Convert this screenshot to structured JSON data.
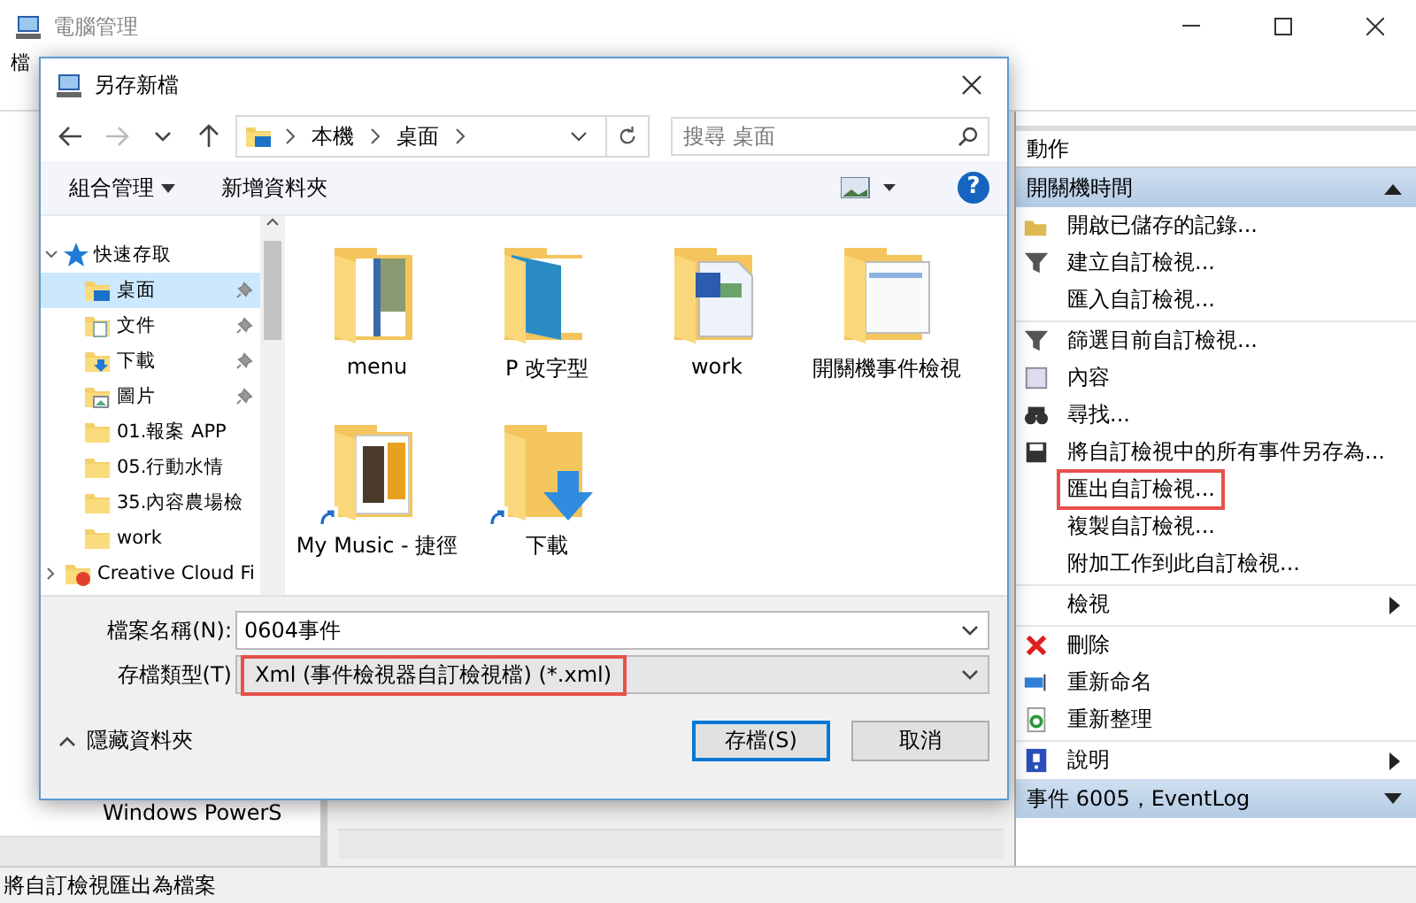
{
  "window": {
    "title": "電腦管理",
    "menu": [
      "檔"
    ]
  },
  "tree_behind": [
    "Windows PowerS"
  ],
  "actions": {
    "header": "動作",
    "sections": [
      {
        "title": "開關機時間",
        "expanded": true,
        "items": [
          {
            "label": "開啟已儲存的記錄...",
            "kind": "open",
            "divider": false,
            "submenu": false,
            "highlighted": false
          },
          {
            "label": "建立自訂檢視...",
            "kind": "filter",
            "divider": false,
            "submenu": false,
            "highlighted": false
          },
          {
            "label": "匯入自訂檢視...",
            "kind": "plain",
            "divider": false,
            "submenu": false,
            "highlighted": false
          },
          {
            "label": "篩選目前自訂檢視...",
            "kind": "filter",
            "divider": true,
            "submenu": false,
            "highlighted": false
          },
          {
            "label": "內容",
            "kind": "properties",
            "divider": false,
            "submenu": false,
            "highlighted": false
          },
          {
            "label": "尋找...",
            "kind": "find",
            "divider": false,
            "submenu": false,
            "highlighted": false
          },
          {
            "label": "將自訂檢視中的所有事件另存為...",
            "kind": "save",
            "divider": false,
            "submenu": false,
            "highlighted": false
          },
          {
            "label": "匯出自訂檢視...",
            "kind": "plain",
            "divider": false,
            "submenu": false,
            "highlighted": true
          },
          {
            "label": "複製自訂檢視...",
            "kind": "plain",
            "divider": false,
            "submenu": false,
            "highlighted": false
          },
          {
            "label": "附加工作到此自訂檢視...",
            "kind": "plain",
            "divider": false,
            "submenu": false,
            "highlighted": false
          },
          {
            "label": "檢視",
            "kind": "plain",
            "divider": true,
            "submenu": true,
            "highlighted": false
          },
          {
            "label": "刪除",
            "kind": "delete",
            "divider": true,
            "submenu": false,
            "highlighted": false
          },
          {
            "label": "重新命名",
            "kind": "rename",
            "divider": false,
            "submenu": false,
            "highlighted": false
          },
          {
            "label": "重新整理",
            "kind": "refresh",
            "divider": false,
            "submenu": false,
            "highlighted": false
          },
          {
            "label": "說明",
            "kind": "help",
            "divider": true,
            "submenu": true,
            "highlighted": false
          }
        ]
      },
      {
        "title": "事件 6005，EventLog",
        "expanded": false
      }
    ]
  },
  "dialog": {
    "title": "另存新檔",
    "path": [
      "本機",
      "桌面"
    ],
    "search": {
      "placeholder": "搜尋 桌面"
    },
    "toolbar": [
      "組合管理",
      "新增資料夾"
    ],
    "help": "?",
    "tree": [
      {
        "label": "快速存取",
        "kind": "star",
        "expanded": true,
        "selected": false,
        "children": [
          {
            "label": "桌面",
            "kind": "desktop",
            "pinned": true,
            "selected": true
          },
          {
            "label": "文件",
            "kind": "docs",
            "pinned": true,
            "selected": false
          },
          {
            "label": "下載",
            "kind": "download",
            "pinned": true,
            "selected": false
          },
          {
            "label": "圖片",
            "kind": "pictures",
            "pinned": true,
            "selected": false
          },
          {
            "label": "01.報案 APP",
            "kind": "folder",
            "pinned": false,
            "selected": false
          },
          {
            "label": "05.行動水情",
            "kind": "folder",
            "pinned": false,
            "selected": false
          },
          {
            "label": "35.內容農場檢",
            "kind": "folder",
            "pinned": false,
            "selected": false
          },
          {
            "label": "work",
            "kind": "folder",
            "pinned": false,
            "selected": false
          }
        ]
      },
      {
        "label": "Creative Cloud Fi",
        "kind": "cloud",
        "expanded": false,
        "selected": false
      }
    ],
    "files": [
      {
        "name": "menu",
        "kind": "brochure",
        "shortcut": false
      },
      {
        "name": "P 改字型",
        "kind": "bluedoc",
        "shortcut": false
      },
      {
        "name": "work",
        "kind": "word",
        "shortcut": false
      },
      {
        "name": "開關機事件檢視",
        "kind": "screens",
        "shortcut": false
      },
      {
        "name": "My Music - 捷徑",
        "kind": "photos",
        "shortcut": true
      },
      {
        "name": "下載",
        "kind": "download",
        "shortcut": true
      }
    ],
    "filename": {
      "label": "檔案名稱(N):",
      "value": "0604事件"
    },
    "filetype": {
      "label": "存檔類型(T)",
      "value": "Xml (事件檢視器自訂檢視檔) (*.xml)",
      "highlighted": true
    },
    "hide_folders": "隱藏資料夾",
    "buttons": [
      {
        "label": "存檔(S)",
        "default": true
      },
      {
        "label": "取消",
        "default": false
      }
    ]
  },
  "status_bar": "將自訂檢視匯出為檔案"
}
